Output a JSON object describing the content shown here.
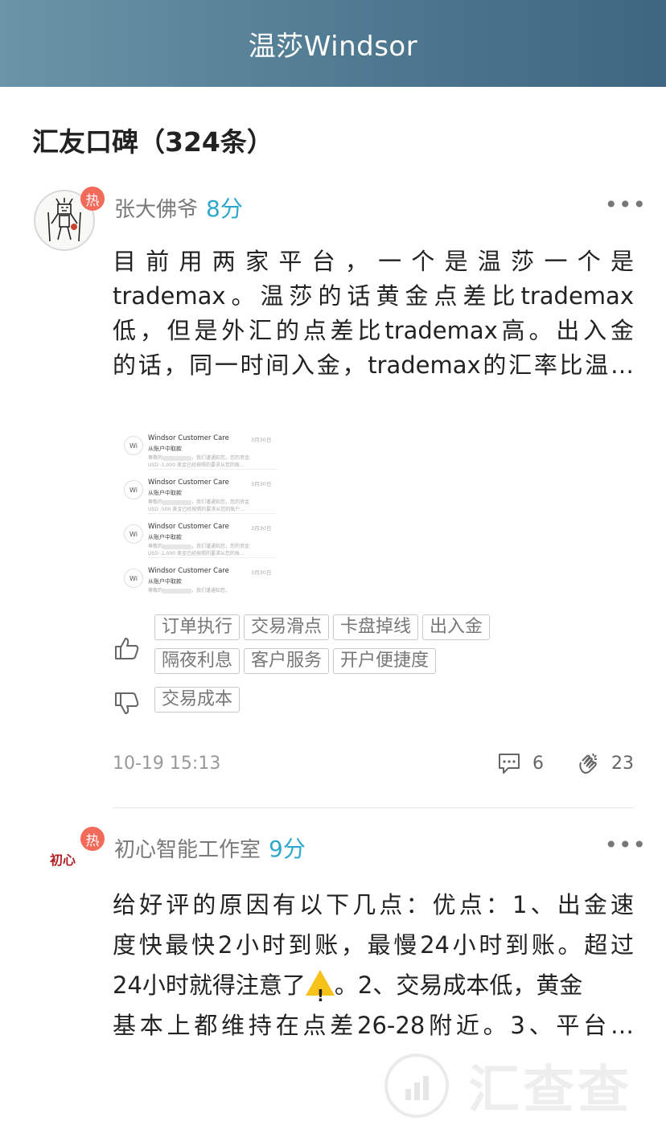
{
  "header": {
    "title": "温莎Windsor"
  },
  "section": {
    "title": "汇友口碑（324条）"
  },
  "reviews": [
    {
      "author": "张大佛爷",
      "score": "8分",
      "hot_badge": "热",
      "more": "•••",
      "text_lines": [
        "目前用两家平台，一个是温莎一个是",
        "trademax。温莎的话黄金点差比trademax",
        "低，但是外汇的点差比trademax高。出入金",
        "的话，同一时间入金，trademax的汇率比温…"
      ],
      "screenshot": {
        "avatar_text": "Wi",
        "items": [
          {
            "name": "Windsor Customer Care",
            "date": "3月30日",
            "subject": "从账户中取款",
            "line1_a": "尊敬的",
            "line1_b": "，我们谨通知您，您的资金",
            "line2": "USD -1,000 美金已经按照的要求从您的账..."
          },
          {
            "name": "Windsor Customer Care",
            "date": "3月30日",
            "subject": "从账户中取款",
            "line1_a": "尊敬的",
            "line1_b": "，我们谨通知您，您的资金",
            "line2": "USD -500 美金已经按照的要求从您的账户..."
          },
          {
            "name": "Windsor Customer Care",
            "date": "3月30日",
            "subject": "从账户中取款",
            "line1_a": "尊敬的",
            "line1_b": "，我们谨通知您，您的资金",
            "line2": "USD -1,000 美金已经按照的要求从您的账..."
          },
          {
            "name": "Windsor Customer Care",
            "date": "3月30日",
            "subject": "从账户中取款",
            "line1_a": "尊敬的",
            "line1_b": "，我们谨通知您，",
            "line2": ""
          }
        ]
      },
      "pros": [
        "订单执行",
        "交易滑点",
        "卡盘掉线",
        "出入金",
        "隔夜利息",
        "客户服务",
        "开户便捷度"
      ],
      "cons": [
        "交易成本"
      ],
      "time": "10-19 15:13",
      "comments": "6",
      "likes": "23"
    },
    {
      "author": "初心智能工作室",
      "score": "9分",
      "hot_badge": "热",
      "more": "•••",
      "avatar_text": "初心",
      "text_lines": [
        "给好评的原因有以下几点：优点：1、出金速",
        "度快最快2小时到账，最慢24小时到账。超过",
        "24小时就得注意了",
        "。2、交易成本低，黄金",
        "基本上都维持在点差26-28附近。3、平台…"
      ]
    }
  ],
  "watermark": {
    "text": "汇查查"
  }
}
